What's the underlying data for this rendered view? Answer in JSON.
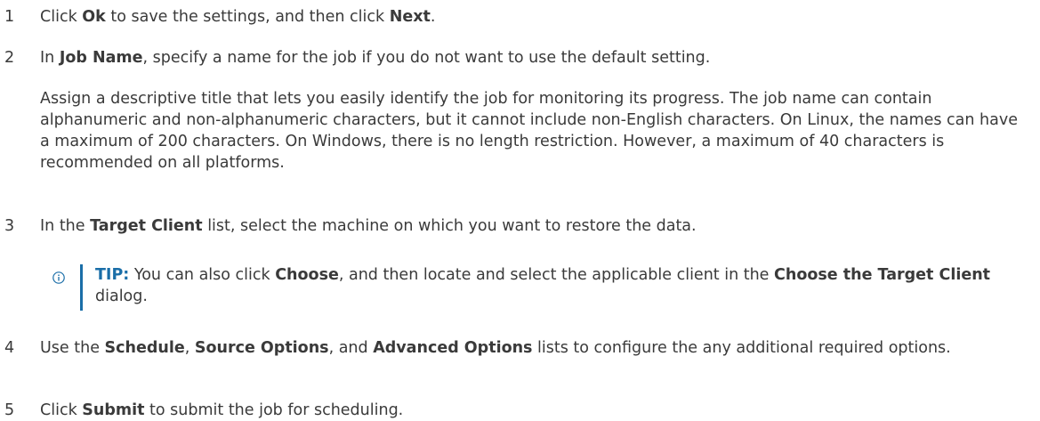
{
  "steps": {
    "s1": {
      "num": "1",
      "t1": "Click ",
      "b1": "Ok",
      "t2": " to save the settings, and then click ",
      "b2": "Next",
      "t3": "."
    },
    "s2": {
      "num": "2",
      "t1": "In ",
      "b1": "Job Name",
      "t2": ", specify a name for the job if you do not want to use the default setting.",
      "para": "Assign a descriptive title that lets you easily identify the job for monitoring its progress. The job name can contain alphanumeric and non-alphanumeric characters, but it cannot include non-English characters. On Linux, the names can have a maximum of 200 characters. On Windows, there is no length restriction. However, a maximum of 40 characters is recommended on all platforms."
    },
    "s3": {
      "num": "3",
      "t1": "In the ",
      "b1": "Target Client",
      "t2": " list, select the machine on which you want to restore the data."
    },
    "tip": {
      "label": "TIP:",
      "t1": " You can also click ",
      "b1": "Choose",
      "t2": ", and then locate and select the applicable client in the ",
      "b2": "Choose the Target Client",
      "t3": " dialog."
    },
    "s4": {
      "num": "4",
      "t1": "Use the ",
      "b1": "Schedule",
      "t2": ", ",
      "b2": "Source Options",
      "t3": ", and ",
      "b3": "Advanced Options",
      "t4": " lists to configure the any additional required options."
    },
    "s5": {
      "num": "5",
      "t1": "Click ",
      "b1": "Submit",
      "t2": " to submit the job for scheduling."
    }
  },
  "colors": {
    "text": "#3a3a3a",
    "accent": "#1a6ea8"
  },
  "icons": {
    "tip": "info-circle-icon"
  }
}
